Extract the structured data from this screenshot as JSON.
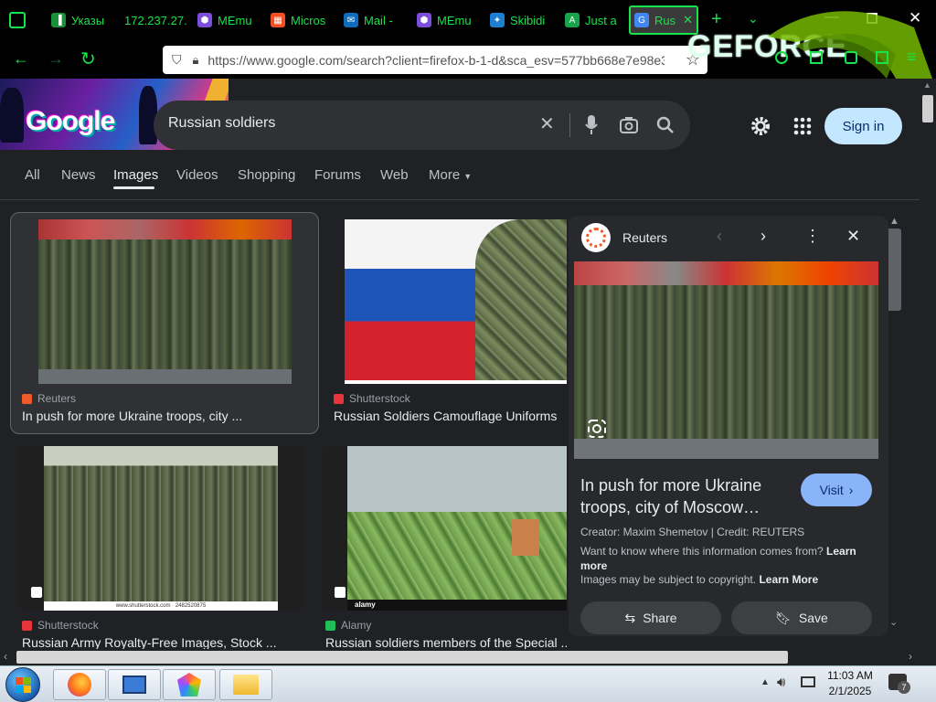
{
  "browser": {
    "tabs": [
      {
        "label": "Указы",
        "color": "#1a8f3a",
        "glyph": "▐"
      },
      {
        "label": "172.237.27.",
        "color": "#000000",
        "glyph": ""
      },
      {
        "label": "MEmu",
        "color": "#7b4fd8",
        "glyph": "⬢"
      },
      {
        "label": "Micros",
        "color": "#f25022",
        "glyph": "▦"
      },
      {
        "label": "Mail -",
        "color": "#0f6cbd",
        "glyph": "✉"
      },
      {
        "label": "MEmu",
        "color": "#7b4fd8",
        "glyph": "⬢"
      },
      {
        "label": "Skibidi",
        "color": "#1d7fd1",
        "glyph": "✦"
      },
      {
        "label": "Just a",
        "color": "#19a34a",
        "glyph": "A"
      },
      {
        "label": "Rus",
        "color": "#4285f4",
        "glyph": "G"
      }
    ],
    "url": "https://www.google.com/search?client=firefox-b-1-d&sca_esv=577bb668e7e98e3",
    "url_host": "google.com",
    "overlay_logo": "GEFORCE"
  },
  "google": {
    "logo": "Google",
    "query": "Russian soldiers",
    "sign_in": "Sign in",
    "tabs": [
      "All",
      "News",
      "Images",
      "Videos",
      "Shopping",
      "Forums",
      "Web",
      "More"
    ],
    "active_tab": "Images"
  },
  "results": [
    {
      "source": "Reuters",
      "title": "In push for more Ukraine troops, city ...",
      "src_color": "#f05a28"
    },
    {
      "source": "Shutterstock",
      "title": "Russian Soldiers Camouflage Uniforms",
      "src_color": "#e8343a"
    },
    {
      "source": "Shutterstock",
      "title": "Russian Army Royalty-Free Images, Stock ...",
      "src_color": "#e8343a",
      "watermark": "www.shutterstock.com · 2482520875"
    },
    {
      "source": "Alamy",
      "title": "Russian soldiers members of the Special ...",
      "src_color": "#1fbf5a",
      "watermark": "alamy"
    }
  ],
  "panel": {
    "source": "Reuters",
    "title": "In push for more Ukraine troops, city of Moscow…",
    "visit": "Visit",
    "creator": "Creator: Maxim Shemetov | Credit: REUTERS",
    "info": "Want to know where this information comes from?",
    "learn_more_1": "Learn more",
    "copyright": "Images may be subject to copyright.",
    "learn_more_2": "Learn More",
    "share": "Share",
    "save": "Save"
  },
  "taskbar": {
    "time": "11:03 AM",
    "date": "2/1/2025",
    "notifications": "7"
  }
}
